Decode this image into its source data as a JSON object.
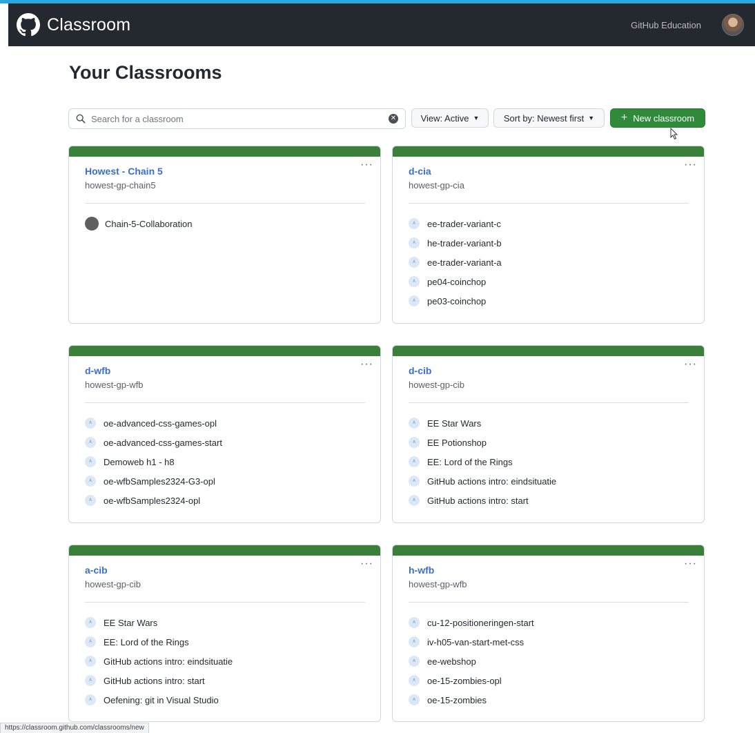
{
  "header": {
    "brand": "Classroom",
    "nav_link": "GitHub Education"
  },
  "page_title": "Your Classrooms",
  "toolbar": {
    "search_placeholder": "Search for a classroom",
    "view_label": "View: Active",
    "sort_label": "Sort by: Newest first",
    "new_label": "New classroom"
  },
  "colors": {
    "accent_green": "#2f8a3a",
    "card_band": "#3a7f3a",
    "link_blue": "#3b6fc9",
    "navbar": "#24292f"
  },
  "classrooms": [
    {
      "name": "Howest - Chain 5",
      "org": "howest-gp-chain5",
      "assignments": [
        "Chain-5-Collaboration"
      ]
    },
    {
      "name": "d-cia",
      "org": "howest-gp-cia",
      "assignments": [
        "ee-trader-variant-c",
        "he-trader-variant-b",
        "ee-trader-variant-a",
        "pe04-coinchop",
        "pe03-coinchop"
      ]
    },
    {
      "name": "d-wfb",
      "org": "howest-gp-wfb",
      "assignments": [
        "oe-advanced-css-games-opl",
        "oe-advanced-css-games-start",
        "Demoweb h1 - h8",
        "oe-wfbSamples2324-G3-opl",
        "oe-wfbSamples2324-opl"
      ]
    },
    {
      "name": "d-cib",
      "org": "howest-gp-cib",
      "assignments": [
        "EE Star Wars",
        "EE Potionshop",
        "EE: Lord of the Rings",
        "GitHub actions intro: eindsituatie",
        "GitHub actions intro: start"
      ]
    },
    {
      "name": "a-cib",
      "org": "howest-gp-cib",
      "assignments": [
        "EE Star Wars",
        "EE: Lord of the Rings",
        "GitHub actions intro: eindsituatie",
        "GitHub actions intro: start",
        "Oefening: git in Visual Studio"
      ]
    },
    {
      "name": "h-wfb",
      "org": "howest-gp-wfb",
      "assignments": [
        "cu-12-positioneringen-start",
        "iv-h05-van-start-met-css",
        "ee-webshop",
        "oe-15-zombies-opl",
        "oe-15-zombies"
      ]
    }
  ],
  "status_url": "https://classroom.github.com/classrooms/new"
}
